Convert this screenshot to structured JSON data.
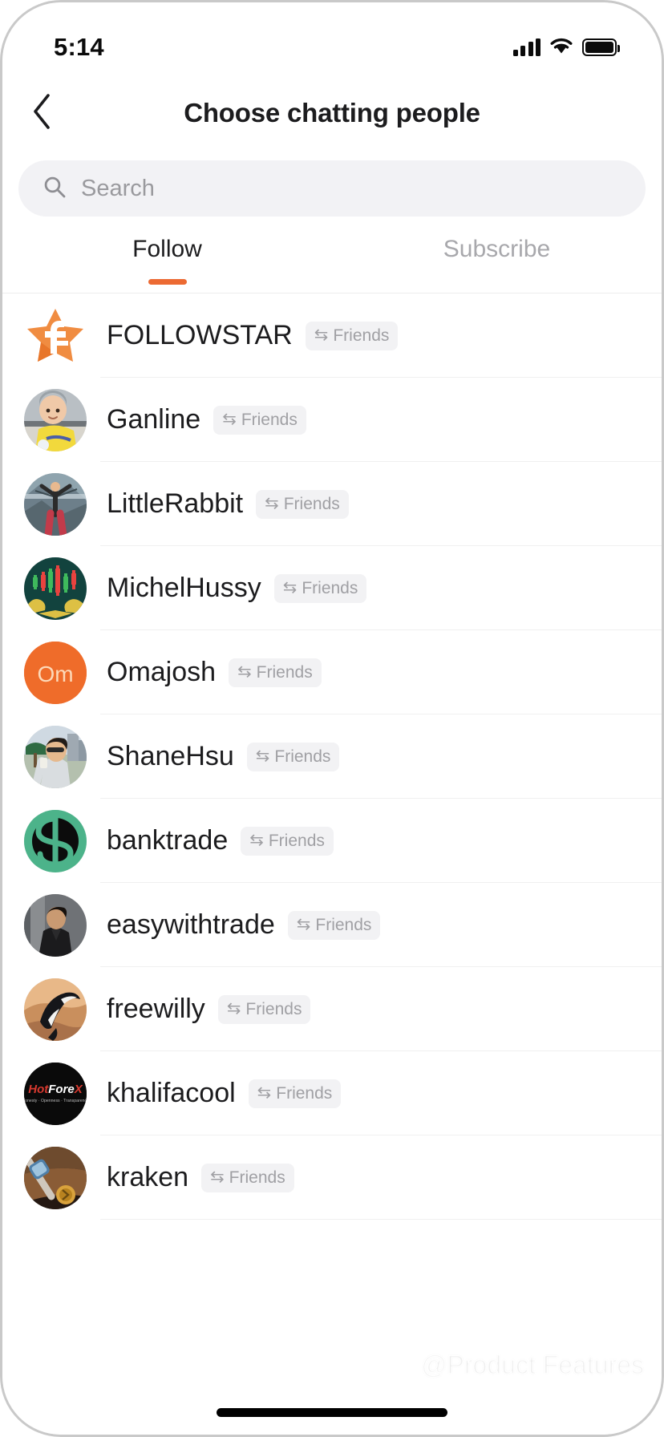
{
  "status_bar": {
    "time": "5:14",
    "signal_icon": "cellular-signal-icon",
    "wifi_icon": "wifi-icon",
    "battery_icon": "battery-full-icon"
  },
  "header": {
    "back_icon": "chevron-left-icon",
    "title": "Choose chatting people"
  },
  "search": {
    "icon": "search-icon",
    "placeholder": "Search",
    "value": ""
  },
  "tabs": {
    "active_index": 0,
    "accent_color": "#ec6a33",
    "items": [
      {
        "label": "Follow"
      },
      {
        "label": "Subscribe"
      }
    ]
  },
  "list": {
    "badge_icon": "exchange-arrows-icon",
    "items": [
      {
        "name": "FOLLOWSTAR",
        "badge": "Friends",
        "avatar": "followstar-logo"
      },
      {
        "name": "Ganline",
        "badge": "Friends",
        "avatar": "baby-photo"
      },
      {
        "name": "LittleRabbit",
        "badge": "Friends",
        "avatar": "person-arms-raised-photo"
      },
      {
        "name": "MichelHussy",
        "badge": "Friends",
        "avatar": "candlestick-chart-bull-bear"
      },
      {
        "name": "Omajosh",
        "badge": "Friends",
        "avatar": "initials-om"
      },
      {
        "name": "ShaneHsu",
        "badge": "Friends",
        "avatar": "man-outdoors-photo"
      },
      {
        "name": "banktrade",
        "badge": "Friends",
        "avatar": "green-dollar-sign-logo"
      },
      {
        "name": "easywithtrade",
        "badge": "Friends",
        "avatar": "man-dark-shirt-photo"
      },
      {
        "name": "freewilly",
        "badge": "Friends",
        "avatar": "orca-whale-photo"
      },
      {
        "name": "khalifacool",
        "badge": "Friends",
        "avatar": "hotforex-logo"
      },
      {
        "name": "kraken",
        "badge": "Friends",
        "avatar": "watch-photo"
      }
    ]
  },
  "avatar_initials": {
    "omajosh": "Om"
  },
  "avatar_logo_text": {
    "hotforex_main": "HotForex",
    "hotforex_tagline": "Honesty · Openness · Transparency"
  },
  "watermark": {
    "icon": "followstar-f-icon",
    "text": "@Product Features"
  },
  "home_indicator": "home-indicator-bar"
}
